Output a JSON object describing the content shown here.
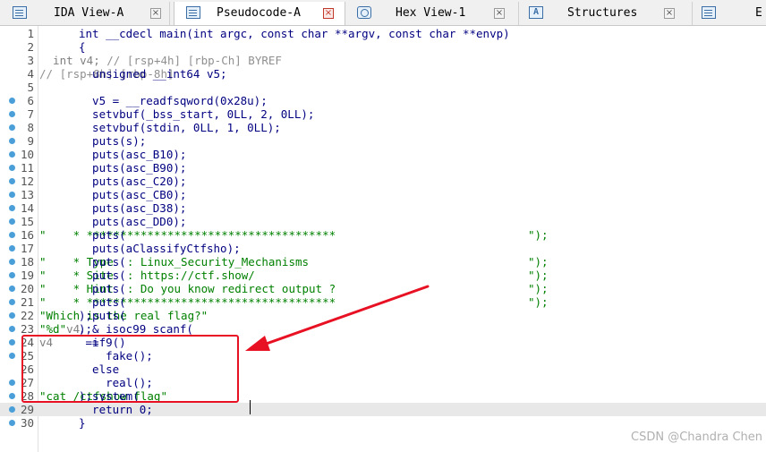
{
  "tabs": [
    {
      "label": "IDA View-A",
      "icon": "listing-icon",
      "active": false
    },
    {
      "label": "Pseudocode-A",
      "icon": "pseudocode-icon",
      "active": true
    },
    {
      "label": "Hex View-1",
      "icon": "hex-view-icon",
      "active": false
    },
    {
      "label": "Structures",
      "icon": "structures-icon",
      "active": false
    },
    {
      "label": "E",
      "icon": "enums-icon",
      "active": false
    }
  ],
  "close_glyph": "×",
  "struct_glyph": "A",
  "code_lines": [
    {
      "num": "1",
      "bp": false,
      "parts": [
        {
          "t": "int __cdecl main(int argc, const char **argv, const char **envp)",
          "c": "code"
        }
      ]
    },
    {
      "num": "2",
      "bp": false,
      "parts": [
        {
          "t": "{",
          "c": "code"
        }
      ]
    },
    {
      "num": "3",
      "bp": false,
      "parts": [
        {
          "t": "  int v4; ",
          "c": "var"
        },
        {
          "t": "// [rsp+4h] [rbp-Ch] BYREF",
          "c": "cmt"
        }
      ]
    },
    {
      "num": "4",
      "bp": false,
      "parts": [
        {
          "t": "  unsigned __int64 v5; ",
          "c": "code"
        },
        {
          "t": "// [rsp+8h] [rbp-8h]",
          "c": "cmt"
        }
      ]
    },
    {
      "num": "5",
      "bp": false,
      "parts": [
        {
          "t": "",
          "c": "code"
        }
      ]
    },
    {
      "num": "6",
      "bp": true,
      "parts": [
        {
          "t": "  v5 = __readfsqword(0x28u);",
          "c": "code"
        }
      ]
    },
    {
      "num": "7",
      "bp": true,
      "parts": [
        {
          "t": "  setvbuf(_bss_start, 0LL, 2, 0LL);",
          "c": "code"
        }
      ]
    },
    {
      "num": "8",
      "bp": true,
      "parts": [
        {
          "t": "  setvbuf(stdin, 0LL, 1, 0LL);",
          "c": "code"
        }
      ]
    },
    {
      "num": "9",
      "bp": true,
      "parts": [
        {
          "t": "  puts(s);",
          "c": "code"
        }
      ]
    },
    {
      "num": "10",
      "bp": true,
      "parts": [
        {
          "t": "  puts(asc_B10);",
          "c": "code"
        }
      ]
    },
    {
      "num": "11",
      "bp": true,
      "parts": [
        {
          "t": "  puts(asc_B90);",
          "c": "code"
        }
      ]
    },
    {
      "num": "12",
      "bp": true,
      "parts": [
        {
          "t": "  puts(asc_C20);",
          "c": "code"
        }
      ]
    },
    {
      "num": "13",
      "bp": true,
      "parts": [
        {
          "t": "  puts(asc_CB0);",
          "c": "code"
        }
      ]
    },
    {
      "num": "14",
      "bp": true,
      "parts": [
        {
          "t": "  puts(asc_D38);",
          "c": "code"
        }
      ]
    },
    {
      "num": "15",
      "bp": true,
      "parts": [
        {
          "t": "  puts(asc_DD0);",
          "c": "code"
        }
      ]
    },
    {
      "num": "16",
      "bp": true,
      "parts": [
        {
          "t": "  puts(",
          "c": "code"
        },
        {
          "t": "\"    * *************************************",
          "c": "str"
        }
      ],
      "tail": "\");"
    },
    {
      "num": "17",
      "bp": true,
      "parts": [
        {
          "t": "  puts(aClassifyCtfsho);",
          "c": "code"
        }
      ]
    },
    {
      "num": "18",
      "bp": true,
      "parts": [
        {
          "t": "  puts(",
          "c": "code"
        },
        {
          "t": "\"    * Type  : Linux_Security_Mechanisms",
          "c": "str"
        }
      ],
      "tail": "\");"
    },
    {
      "num": "19",
      "bp": true,
      "parts": [
        {
          "t": "  puts(",
          "c": "code"
        },
        {
          "t": "\"    * Site  : https://ctf.show/",
          "c": "str"
        }
      ],
      "tail": "\");"
    },
    {
      "num": "20",
      "bp": true,
      "parts": [
        {
          "t": "  puts(",
          "c": "code"
        },
        {
          "t": "\"    * Hint  : Do you know redirect output ?",
          "c": "str"
        }
      ],
      "tail": "\");"
    },
    {
      "num": "21",
      "bp": true,
      "parts": [
        {
          "t": "  puts(",
          "c": "code"
        },
        {
          "t": "\"    * *************************************",
          "c": "str"
        }
      ],
      "tail": "\");"
    },
    {
      "num": "22",
      "bp": true,
      "parts": [
        {
          "t": "  puts(",
          "c": "code"
        },
        {
          "t": "\"Which is the real flag?\"",
          "c": "str"
        },
        {
          "t": ");",
          "c": "code"
        }
      ]
    },
    {
      "num": "23",
      "bp": true,
      "parts": [
        {
          "t": "  __isoc99_scanf(",
          "c": "code"
        },
        {
          "t": "\"%d\"",
          "c": "str"
        },
        {
          "t": ", &",
          "c": "code"
        },
        {
          "t": "v4",
          "c": "var"
        },
        {
          "t": ");",
          "c": "code"
        }
      ]
    },
    {
      "num": "24",
      "bp": true,
      "parts": [
        {
          "t": "  if ( ",
          "c": "code"
        },
        {
          "t": "v4",
          "c": "var"
        },
        {
          "t": " == 9 )",
          "c": "code"
        }
      ]
    },
    {
      "num": "25",
      "bp": true,
      "parts": [
        {
          "t": "    fake();",
          "c": "code"
        }
      ]
    },
    {
      "num": "26",
      "bp": false,
      "parts": [
        {
          "t": "  else",
          "c": "code"
        }
      ]
    },
    {
      "num": "27",
      "bp": true,
      "parts": [
        {
          "t": "    real();",
          "c": "code"
        }
      ]
    },
    {
      "num": "28",
      "bp": true,
      "parts": [
        {
          "t": "  system(",
          "c": "code"
        },
        {
          "t": "\"cat /ctfshow_flag\"",
          "c": "str"
        },
        {
          "t": ");",
          "c": "code"
        }
      ]
    },
    {
      "num": "29",
      "bp": true,
      "parts": [
        {
          "t": "  return 0;",
          "c": "code"
        }
      ],
      "highlight": true
    },
    {
      "num": "30",
      "bp": true,
      "parts": [
        {
          "t": "}",
          "c": "code"
        }
      ]
    }
  ],
  "watermark": "CSDN @Chandra Chen",
  "colors": {
    "annotation": "#e81123",
    "breakpoint": "#4a9fd8",
    "keyword": "#000080",
    "string": "#008000",
    "comment": "#909090"
  }
}
